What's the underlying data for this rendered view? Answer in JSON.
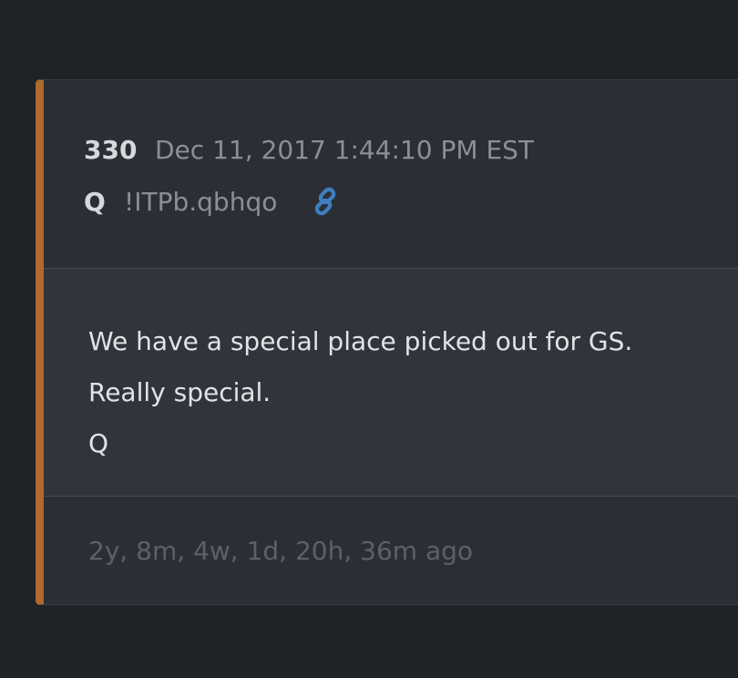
{
  "post": {
    "number": "330",
    "date": "Dec 11, 2017 1:44:10 PM EST",
    "author": "Q",
    "tripcode": "!ITPb.qbhqo",
    "link_icon": "link-icon",
    "body_lines": [
      "We have a special place picked out for GS.",
      "Really special.",
      "Q"
    ],
    "time_ago": "2y, 8m, 4w, 1d, 20h, 36m ago"
  },
  "colors": {
    "page_background": "#1f2226",
    "card_background": "#2b2f35",
    "body_background": "#30353c",
    "accent_bar": "#b06a2c",
    "link_icon": "#3f7fc0",
    "primary_text": "#e1e3e6",
    "muted_text": "#8a8f98",
    "faint_text": "#5b616a"
  }
}
